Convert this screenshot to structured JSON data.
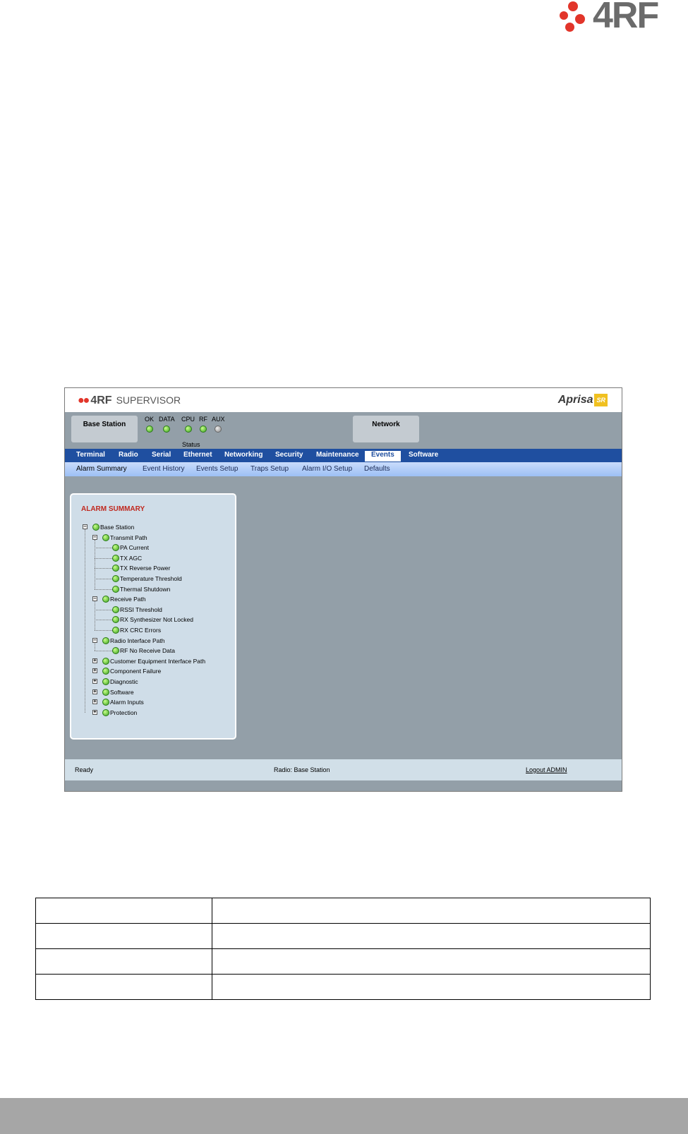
{
  "page_logo": {
    "text": "4RF"
  },
  "app": {
    "logo_text": "4RF",
    "product": "SUPERVISOR",
    "brand": "Aprisa",
    "brand_badge": "SR"
  },
  "header": {
    "station": "Base Station",
    "network": "Network",
    "status_label": "Status",
    "leds": [
      {
        "label": "OK",
        "state": "green"
      },
      {
        "label": "DATA",
        "state": "green"
      },
      {
        "label": "CPU",
        "state": "green"
      },
      {
        "label": "RF",
        "state": "green"
      },
      {
        "label": "AUX",
        "state": "off"
      }
    ]
  },
  "nav": {
    "main": [
      "Terminal",
      "Radio",
      "Serial",
      "Ethernet",
      "Networking",
      "Security",
      "Maintenance",
      "Events",
      "Software"
    ],
    "active_main": "Events",
    "sub": [
      "Alarm Summary",
      "Event History",
      "Events Setup",
      "Traps Setup",
      "Alarm I/O Setup",
      "Defaults"
    ],
    "active_sub": "Alarm Summary"
  },
  "alarm_summary": {
    "title": "ALARM SUMMARY",
    "tree": [
      {
        "label": "Base Station",
        "level": 0,
        "expander": "minus"
      },
      {
        "label": "Transmit Path",
        "level": 1,
        "expander": "minus"
      },
      {
        "label": "PA Current",
        "level": 2
      },
      {
        "label": "TX AGC",
        "level": 2
      },
      {
        "label": "TX Reverse Power",
        "level": 2
      },
      {
        "label": "Temperature Threshold",
        "level": 2
      },
      {
        "label": "Thermal Shutdown",
        "level": 2
      },
      {
        "label": "Receive Path",
        "level": 1,
        "expander": "minus"
      },
      {
        "label": "RSSI Threshold",
        "level": 2
      },
      {
        "label": "RX Synthesizer Not Locked",
        "level": 2
      },
      {
        "label": "RX CRC Errors",
        "level": 2
      },
      {
        "label": "Radio Interface Path",
        "level": 1,
        "expander": "minus"
      },
      {
        "label": "RF No Receive Data",
        "level": 2
      },
      {
        "label": "Customer Equipment Interface Path",
        "level": 1,
        "expander": "plus"
      },
      {
        "label": "Component Failure",
        "level": 1,
        "expander": "plus"
      },
      {
        "label": "Diagnostic",
        "level": 1,
        "expander": "plus"
      },
      {
        "label": "Software",
        "level": 1,
        "expander": "plus"
      },
      {
        "label": "Alarm Inputs",
        "level": 1,
        "expander": "plus"
      },
      {
        "label": "Protection",
        "level": 1,
        "expander": "plus"
      }
    ]
  },
  "statusbar": {
    "left": "Ready",
    "center": "Radio: Base Station",
    "logout": "Logout ADMIN"
  },
  "colors": {
    "nav_blue": "#1f4fa0",
    "alarm_title_red": "#c0281e",
    "led_green": "#3aa020",
    "logo_red": "#e2352a"
  }
}
